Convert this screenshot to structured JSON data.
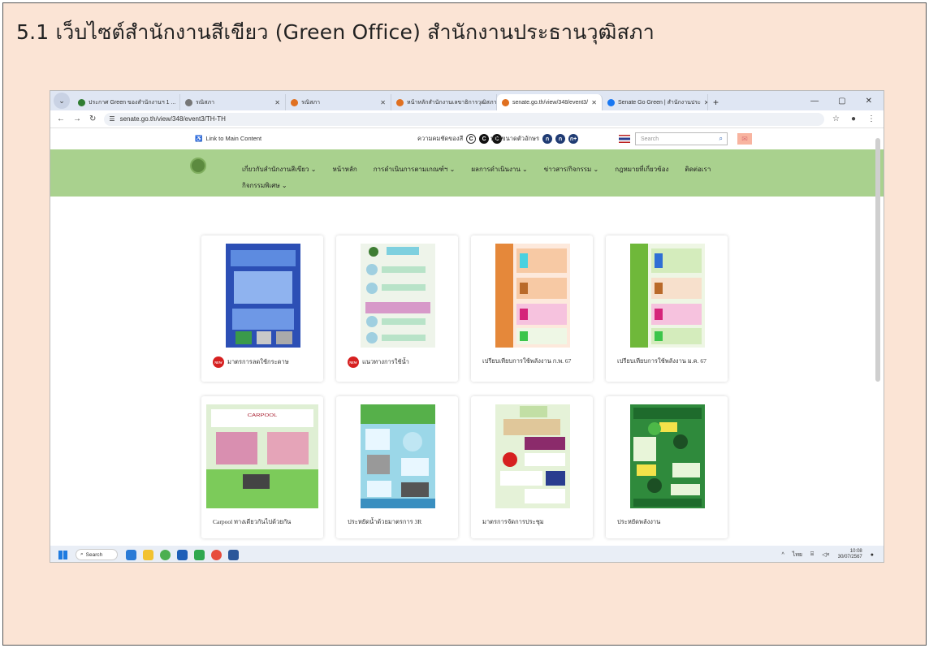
{
  "slide": {
    "title": "5.1 เว็บไซต์สำนักงานสีเขียว (Green Office) สำนักงานประธานวุฒิสภา"
  },
  "browser": {
    "tabs": [
      {
        "label": "ประกาศ Green ของสำนักงานฯ 1 ...",
        "fav_color": "#2f7d32",
        "active": false
      },
      {
        "label": "รณิสภา",
        "fav_color": "#777777",
        "active": false
      },
      {
        "label": "รณิสภา",
        "fav_color": "#e07020",
        "active": false
      },
      {
        "label": "หน้าหลักสำนักงานเลขาธิการวุฒิสภา",
        "fav_color": "#e07020",
        "active": false
      },
      {
        "label": "senate.go.th/view/348/event3/",
        "fav_color": "#e07020",
        "active": true
      },
      {
        "label": "Senate Go Green | สำนักงานประ",
        "fav_color": "#1877f2",
        "active": false
      }
    ],
    "url": "senate.go.th/view/348/event3/TH-TH"
  },
  "site": {
    "skip_link": "Link to Main Content",
    "font_size_label": "ความคมชัดของสี",
    "contrast_label": "ปรับขนาดตัวอักษร",
    "contrast_buttons": [
      "ก",
      "ก",
      "ก+"
    ],
    "color_buttons": [
      "C",
      "C",
      "C"
    ],
    "search_placeholder": "Search",
    "nav": [
      "เกี่ยวกับสำนักงานสีเขียว ⌄",
      "หน้าหลัก",
      "การดำเนินการตามเกณฑ์ฯ ⌄",
      "ผลการดำเนินงาน ⌄",
      "ข่าวสาร/กิจกรรม ⌄",
      "กฎหมายที่เกี่ยวข้อง",
      "ติดต่อเรา"
    ],
    "nav_row2": "กิจกรรมพิเศษ ⌄",
    "cards": [
      {
        "label": "มาตรการลดใช้กระดาษ",
        "new": true
      },
      {
        "label": "แนวทางการใช้น้ำ",
        "new": true
      },
      {
        "label": "เปรียบเทียบการใช้พลังงาน ก.พ. 67",
        "new": false
      },
      {
        "label": "เปรียบเทียบการใช้พลังงาน ม.ค. 67",
        "new": false
      },
      {
        "label": "Carpool ทางเดียวกันไปด้วยกัน",
        "new": false
      },
      {
        "label": "ประหยัดน้ำด้วยมาตรการ 3R",
        "new": false
      },
      {
        "label": "มาตรการจัดการประชุม",
        "new": false
      },
      {
        "label": "ประหยัดพลังงาน",
        "new": false
      }
    ],
    "new_badge": "NEW"
  },
  "taskbar": {
    "search_label": "Search",
    "lang": "ไทย",
    "time": "10:08",
    "date": "30/07/2567"
  }
}
